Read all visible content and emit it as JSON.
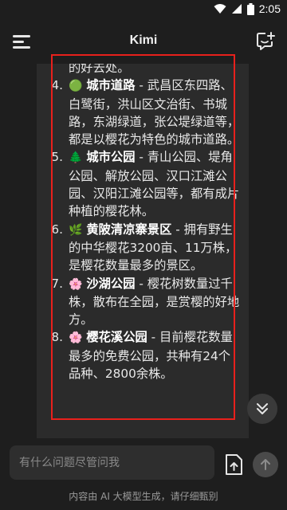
{
  "status": {
    "time": "2:05",
    "icons": [
      "wifi-icon",
      "signal-icon",
      "battery-icon"
    ]
  },
  "header": {
    "title": "Kimi",
    "menu_icon": "menu-icon",
    "new_chat_icon": "new-chat-icon"
  },
  "message": {
    "fragment": "的好去处。",
    "items": [
      {
        "num": "4.",
        "emoji": "🟢",
        "name": "城市道路",
        "text": " - 武昌区东四路、白鹭街，洪山区文治街、书城路，东湖绿道，张公堤绿道等，都是以樱花为特色的城市道路。"
      },
      {
        "num": "5.",
        "emoji": "🌲",
        "name": "城市公园",
        "text": " - 青山公园、堤角公园、解放公园、汉口江滩公园、汉阳江滩公园等，都有成片种植的樱花林。"
      },
      {
        "num": "6.",
        "emoji": "🌿",
        "name": "黄陂清凉寨景区",
        "text": " - 拥有野生的中华樱花3200亩、11万株，是樱花数量最多的景区。"
      },
      {
        "num": "7.",
        "emoji": "🌸",
        "name": "沙湖公园",
        "text": " - 樱花树数量过千株，散布在全园，是赏樱的好地方。"
      },
      {
        "num": "8.",
        "emoji": "🌸",
        "name": "樱花溪公园",
        "text": " - 目前樱花数量最多的免费公园，共种有24个品种、2800余株。"
      }
    ]
  },
  "composer": {
    "placeholder": "有什么问题尽管问我",
    "upload_icon": "upload-file-icon",
    "send_icon": "send-arrow-icon"
  },
  "footer": {
    "disclaimer": "内容由 AI 大模型生成，请仔细甄别"
  },
  "colors": {
    "background": "#1e1e1e",
    "message_bg": "#2b2b2b",
    "highlight": "#e8201c"
  }
}
